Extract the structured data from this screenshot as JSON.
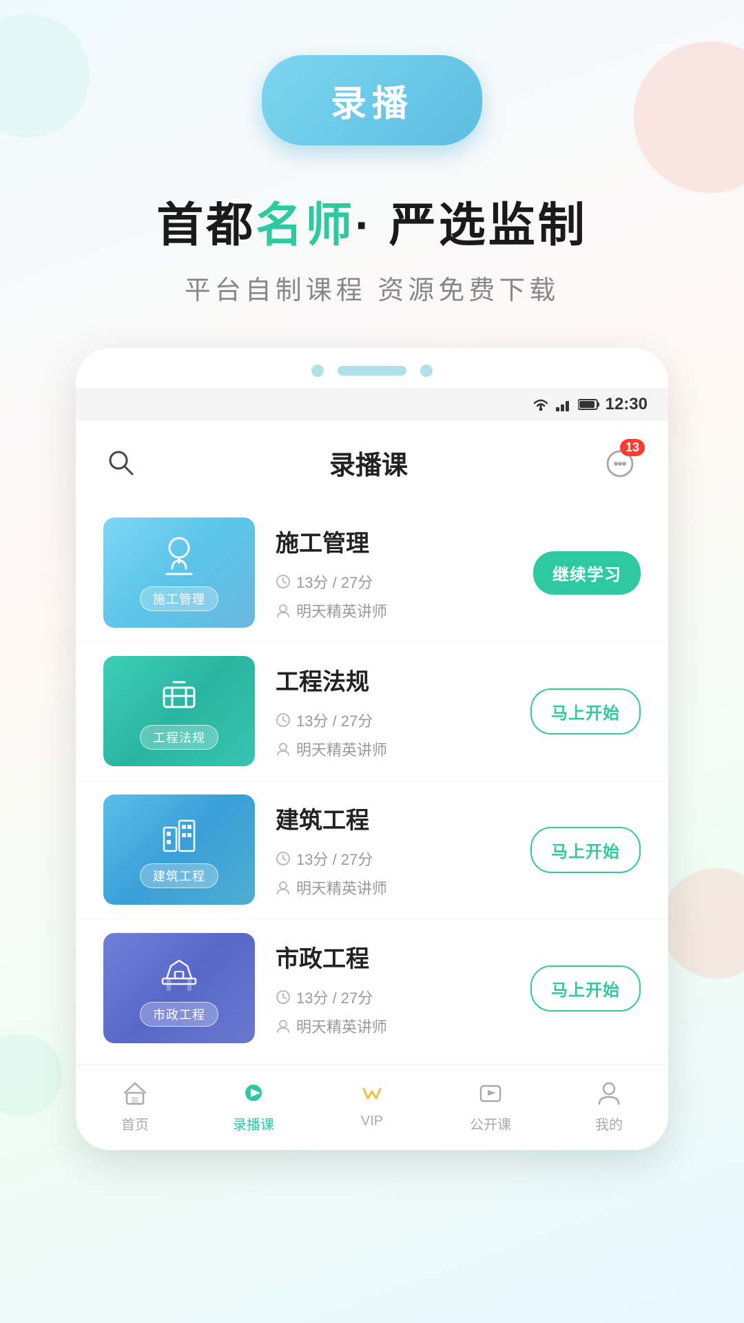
{
  "header": {
    "record_btn": "录播",
    "tagline_prefix": "首都",
    "tagline_highlight": "名师",
    "tagline_suffix": "· 严选监制",
    "subtitle": "平台自制课程 资源免费下载"
  },
  "phone": {
    "status_time": "12:30",
    "app_title": "录播课",
    "msg_badge": "13"
  },
  "courses": [
    {
      "id": 1,
      "name": "施工管理",
      "thumb_label": "施工管理",
      "duration": "13分",
      "total": "27分",
      "teacher": "明天精英讲师",
      "action": "继续学习",
      "action_type": "continue",
      "thumb_class": "thumb-bg-1"
    },
    {
      "id": 2,
      "name": "工程法规",
      "thumb_label": "工程法规",
      "duration": "13分",
      "total": "27分",
      "teacher": "明天精英讲师",
      "action": "马上开始",
      "action_type": "start",
      "thumb_class": "thumb-bg-2"
    },
    {
      "id": 3,
      "name": "建筑工程",
      "thumb_label": "建筑工程",
      "duration": "13分",
      "total": "27分",
      "teacher": "明天精英讲师",
      "action": "马上开始",
      "action_type": "start",
      "thumb_class": "thumb-bg-3"
    },
    {
      "id": 4,
      "name": "市政工程",
      "thumb_label": "市政工程",
      "duration": "13分",
      "total": "27分",
      "teacher": "明天精英讲师",
      "action": "马上开始",
      "action_type": "start",
      "thumb_class": "thumb-bg-4"
    }
  ],
  "nav": {
    "items": [
      {
        "label": "首页",
        "id": "home",
        "active": false
      },
      {
        "label": "录播课",
        "id": "record",
        "active": true
      },
      {
        "label": "VIP",
        "id": "vip",
        "active": false
      },
      {
        "label": "公开课",
        "id": "open",
        "active": false
      },
      {
        "label": "我的",
        "id": "mine",
        "active": false
      }
    ]
  },
  "icons": {
    "search": "🔍",
    "clock": "⏱",
    "user": "👤"
  }
}
